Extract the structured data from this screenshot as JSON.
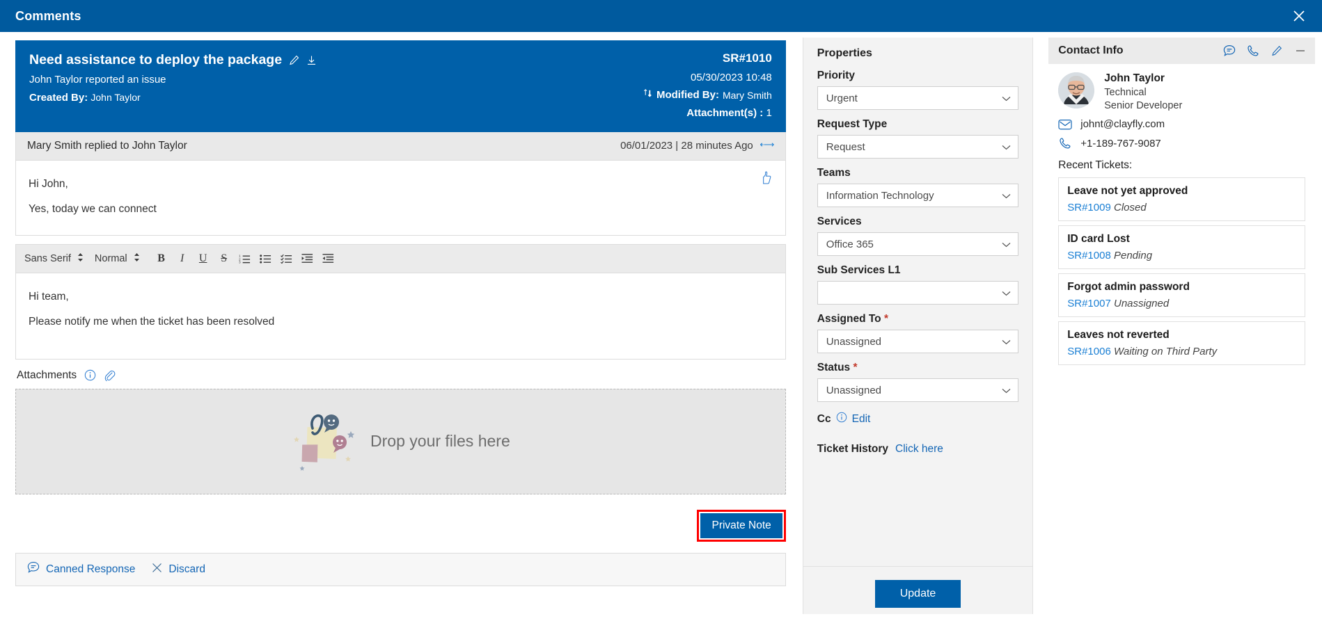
{
  "window": {
    "title": "Comments",
    "close_icon": "close-icon"
  },
  "ticket": {
    "subject": "Need assistance to deploy the package",
    "edit_icon": "pencil-icon",
    "download_icon": "download-icon",
    "summary": "John Taylor reported an issue",
    "created_by_label": "Created By:",
    "created_by": "John Taylor",
    "id": "SR#1010",
    "created_date": "05/30/2023 10:48",
    "sort_icon": "sort-updown-icon",
    "modified_by_label": "Modified By:",
    "modified_by": "Mary Smith",
    "attachments_label": "Attachment(s) :",
    "attachments_count": "1"
  },
  "reply": {
    "header": "Mary Smith replied to John Taylor",
    "date": "06/01/2023 | 28 minutes Ago",
    "reply_icon": "reply-arrows-icon",
    "thumb_icon": "thumbs-up-icon",
    "line1": "Hi John,",
    "line2": "Yes, today we can connect"
  },
  "editor": {
    "font_family": "Sans Serif",
    "font_size": "Normal",
    "buttons": [
      {
        "name": "bold-icon",
        "label": "B"
      },
      {
        "name": "italic-icon",
        "label": "I"
      },
      {
        "name": "underline-icon",
        "label": "U"
      },
      {
        "name": "strikethrough-icon",
        "label": "S"
      }
    ],
    "list_buttons": [
      "ordered-list-icon",
      "bullet-list-icon",
      "checklist-icon",
      "outdent-icon",
      "indent-icon"
    ],
    "line1": "Hi team,",
    "line2": "Please notify me when the ticket has been resolved"
  },
  "attachments": {
    "label": "Attachments",
    "info_icon": "info-icon",
    "clip_icon": "paperclip-icon",
    "dropzone_text": "Drop your files here",
    "dropzone_illustration": "files-note-illustration"
  },
  "actions": {
    "private_note": "Private Note",
    "private_note_highlight_color": "#ff0000",
    "canned_response": "Canned Response",
    "canned_icon": "canned-response-icon",
    "discard": "Discard",
    "discard_icon": "close-x-icon"
  },
  "properties": {
    "title": "Properties",
    "fields": [
      {
        "label": "Priority",
        "value": "Urgent",
        "required": false,
        "name": "priority"
      },
      {
        "label": "Request Type",
        "value": "Request",
        "required": false,
        "name": "request-type"
      },
      {
        "label": "Teams",
        "value": "Information Technology",
        "required": false,
        "name": "teams"
      },
      {
        "label": "Services",
        "value": "Office 365",
        "required": false,
        "name": "services"
      },
      {
        "label": "Sub Services L1",
        "value": "",
        "required": false,
        "name": "sub-services-l1"
      },
      {
        "label": "Assigned To",
        "value": "Unassigned",
        "required": true,
        "name": "assigned-to"
      },
      {
        "label": "Status",
        "value": "Unassigned",
        "required": true,
        "name": "status"
      }
    ],
    "cc_label": "Cc",
    "cc_info_icon": "info-icon",
    "cc_edit": "Edit",
    "history_label": "Ticket History",
    "history_link": "Click here",
    "update_button": "Update"
  },
  "contact": {
    "title": "Contact Info",
    "header_icons": [
      "chat-icon",
      "phone-icon",
      "pencil-icon",
      "minimize-icon"
    ],
    "avatar": "user-avatar",
    "name": "John Taylor",
    "department": "Technical",
    "role": "Senior Developer",
    "email_icon": "mail-icon",
    "email": "johnt@clayfly.com",
    "phone_icon": "phone-icon",
    "phone": "+1-189-767-9087",
    "recent_title": "Recent Tickets:",
    "recent_tickets": [
      {
        "title": "Leave not yet approved",
        "id": "SR#1009",
        "status": "Closed"
      },
      {
        "title": "ID card Lost",
        "id": "SR#1008",
        "status": "Pending"
      },
      {
        "title": "Forgot admin password",
        "id": "SR#1007",
        "status": "Unassigned"
      },
      {
        "title": "Leaves not reverted",
        "id": "SR#1006",
        "status": "Waiting on Third Party"
      }
    ]
  },
  "theme": {
    "accent": "#0060a9",
    "link": "#1466b5",
    "required": "#c2392b"
  }
}
